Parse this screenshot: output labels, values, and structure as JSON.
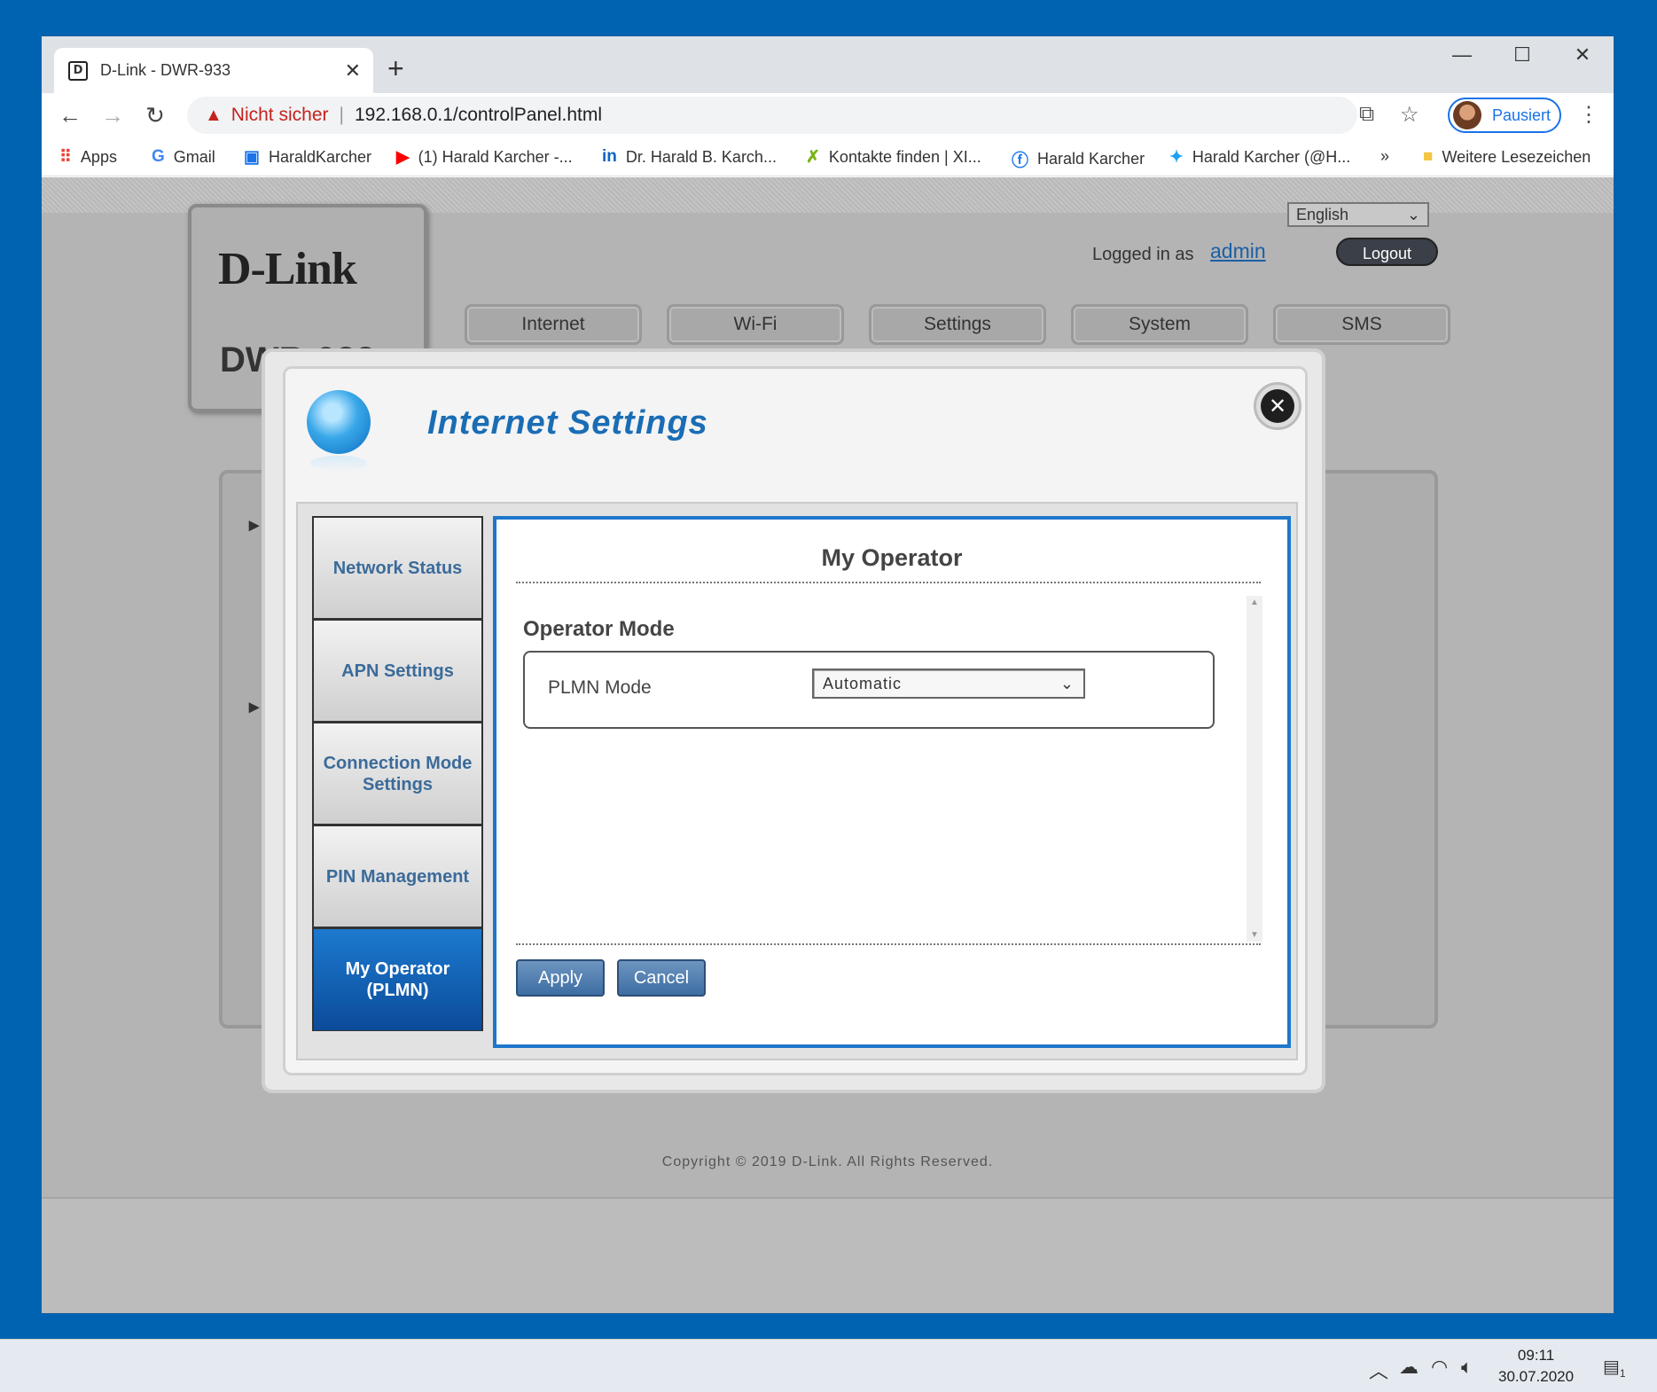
{
  "browser": {
    "tab_title": "D-Link - DWR-933",
    "tab_favicon": "dlink-favicon",
    "security_label": "Nicht sicher",
    "url": "192.168.0.1/controlPanel.html",
    "profile_label": "Pausiert",
    "bookmarks": [
      {
        "label": "Apps",
        "icon": "apps-grid-icon"
      },
      {
        "label": "Gmail",
        "icon": "google-icon"
      },
      {
        "label": "HaraldKarcher",
        "icon": "page-icon"
      },
      {
        "label": "(1) Harald Karcher -...",
        "icon": "youtube-icon"
      },
      {
        "label": "Dr. Harald B. Karch...",
        "icon": "linkedin-icon"
      },
      {
        "label": "Kontakte finden | XI...",
        "icon": "xing-icon"
      },
      {
        "label": "Harald Karcher",
        "icon": "facebook-icon"
      },
      {
        "label": "Harald Karcher (@H...",
        "icon": "twitter-icon"
      },
      {
        "label": "Weitere Lesezeichen",
        "icon": "folder-icon"
      }
    ]
  },
  "router": {
    "brand": "D-Link",
    "model": "DWR-933",
    "language": "English",
    "logged_in_label": "Logged in as",
    "user": "admin",
    "logout_label": "Logout",
    "nav": [
      "Internet",
      "Wi-Fi",
      "Settings",
      "System",
      "SMS"
    ],
    "copyright": "Copyright © 2019 D-Link. All Rights Reserved."
  },
  "modal": {
    "title": "Internet Settings",
    "side_items": [
      "Network Status",
      "APN Settings",
      "Connection Mode Settings",
      "PIN Management",
      "My Operator (PLMN)"
    ],
    "active_item": "My Operator (PLMN)",
    "content_title": "My Operator",
    "section_title": "Operator Mode",
    "field_label": "PLMN Mode",
    "field_value": "Automatic",
    "apply_label": "Apply",
    "cancel_label": "Cancel"
  },
  "taskbar": {
    "time": "09:11",
    "date": "30.07.2020",
    "notification_count": "1"
  },
  "colors": {
    "accent": "#1f77cc",
    "title_blue": "#1a6db5",
    "active_nav": "#0c4b99",
    "desktop": "#0063b1"
  }
}
